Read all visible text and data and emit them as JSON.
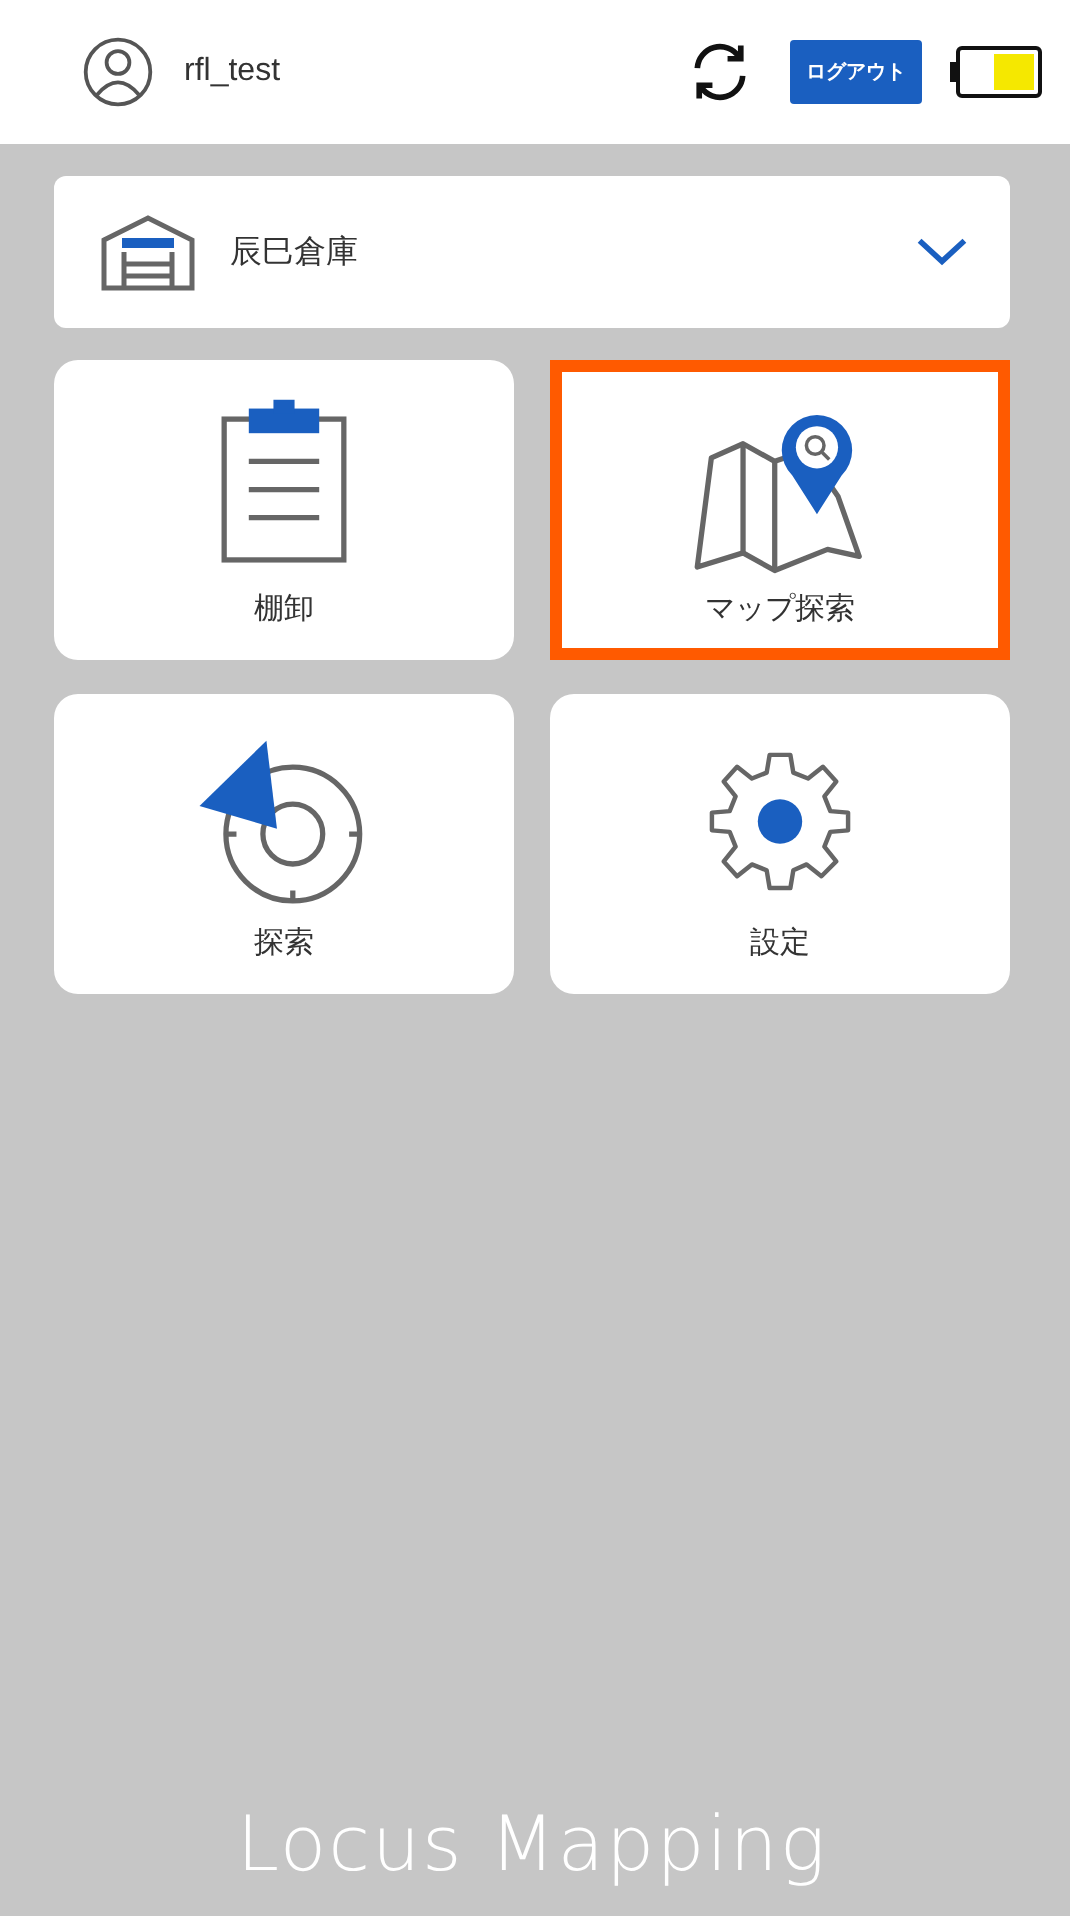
{
  "header": {
    "username": "rfl_test",
    "logout_button": "ログアウト"
  },
  "warehouse_select": {
    "value": "辰巳倉庫"
  },
  "tiles": [
    {
      "kind": "inventory",
      "label": "棚卸",
      "selected": false
    },
    {
      "kind": "map",
      "label": "マップ探索",
      "selected": true
    },
    {
      "kind": "search",
      "label": "探索",
      "selected": false
    },
    {
      "kind": "settings",
      "label": "設定",
      "selected": false
    }
  ],
  "footer": {
    "logo": "Locus Mapping"
  }
}
